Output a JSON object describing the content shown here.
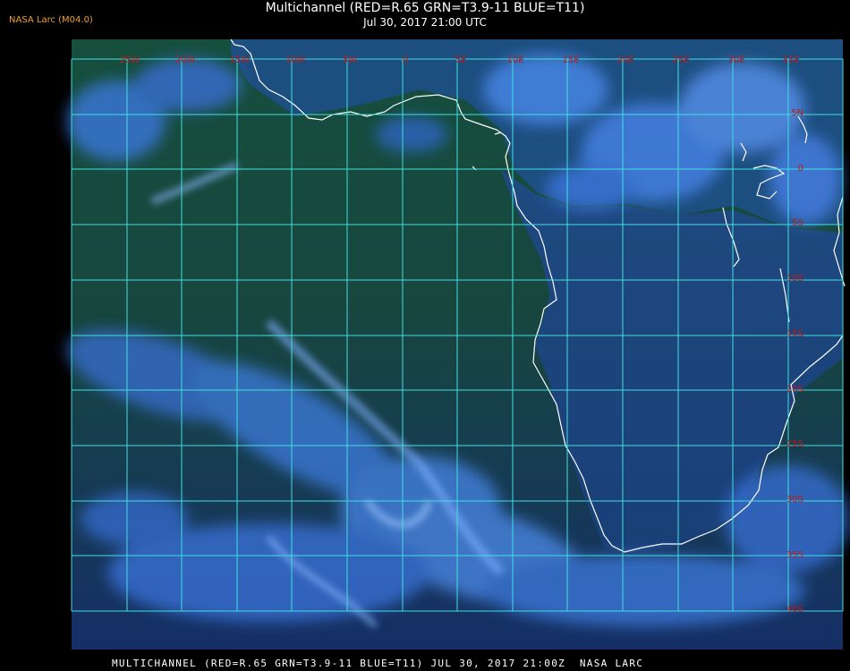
{
  "credit": "NASA Larc (M04.0)",
  "title": "Multichannel (RED=R.65 GRN=T3.9-11 BLUE=T11)",
  "subtitle": "Jul 30, 2017 21:00 UTC",
  "footer": "MULTICHANNEL (RED=R.65 GRN=T3.9-11 BLUE=T11) JUL 30, 2017 21:00Z  NASA LARC",
  "grid_color": "#40e0e0",
  "coast_color": "#ffffff",
  "label_color": "#c01818",
  "lon_labels": [
    "25W",
    "20W",
    "15W",
    "10W",
    "5W",
    "0",
    "5E",
    "10E",
    "15E",
    "20E",
    "25E",
    "30E",
    "35E"
  ],
  "lat_labels": [
    "5N",
    "0",
    "5S",
    "10S",
    "15S",
    "20S",
    "25S",
    "30S",
    "35S",
    "40S"
  ]
}
